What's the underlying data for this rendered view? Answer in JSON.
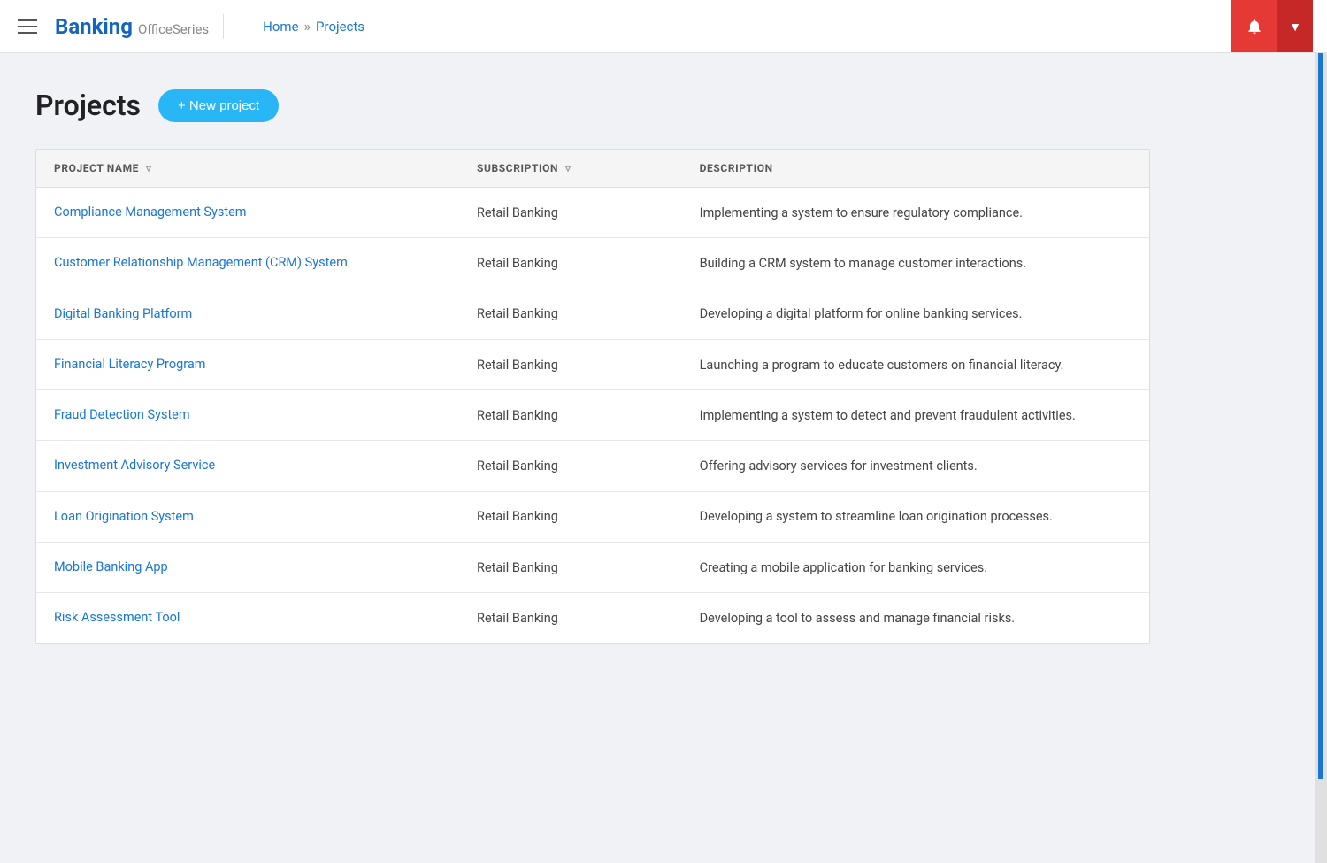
{
  "header": {
    "brand": "Banking",
    "suite": "OfficeSeries",
    "breadcrumb": {
      "home": "Home",
      "separator": "»",
      "current": "Projects"
    },
    "bell_label": "🔔",
    "dropdown_label": "▼"
  },
  "page": {
    "title": "Projects",
    "new_project_btn": "+ New project"
  },
  "table": {
    "columns": [
      {
        "key": "name",
        "label": "PROJECT NAME",
        "has_filter": true
      },
      {
        "key": "subscription",
        "label": "SUBSCRIPTION",
        "has_filter": true
      },
      {
        "key": "description",
        "label": "DESCRIPTION",
        "has_filter": false
      }
    ],
    "rows": [
      {
        "name": "Compliance Management System",
        "subscription": "Retail Banking",
        "description": "Implementing a system to ensure regulatory compliance."
      },
      {
        "name": "Customer Relationship Management (CRM) System",
        "subscription": "Retail Banking",
        "description": "Building a CRM system to manage customer interactions."
      },
      {
        "name": "Digital Banking Platform",
        "subscription": "Retail Banking",
        "description": "Developing a digital platform for online banking services."
      },
      {
        "name": "Financial Literacy Program",
        "subscription": "Retail Banking",
        "description": "Launching a program to educate customers on financial literacy."
      },
      {
        "name": "Fraud Detection System",
        "subscription": "Retail Banking",
        "description": "Implementing a system to detect and prevent fraudulent activities."
      },
      {
        "name": "Investment Advisory Service",
        "subscription": "Retail Banking",
        "description": "Offering advisory services for investment clients."
      },
      {
        "name": "Loan Origination System",
        "subscription": "Retail Banking",
        "description": "Developing a system to streamline loan origination processes."
      },
      {
        "name": "Mobile Banking App",
        "subscription": "Retail Banking",
        "description": "Creating a mobile application for banking services."
      },
      {
        "name": "Risk Assessment Tool",
        "subscription": "Retail Banking",
        "description": "Developing a tool to assess and manage financial risks."
      }
    ]
  }
}
